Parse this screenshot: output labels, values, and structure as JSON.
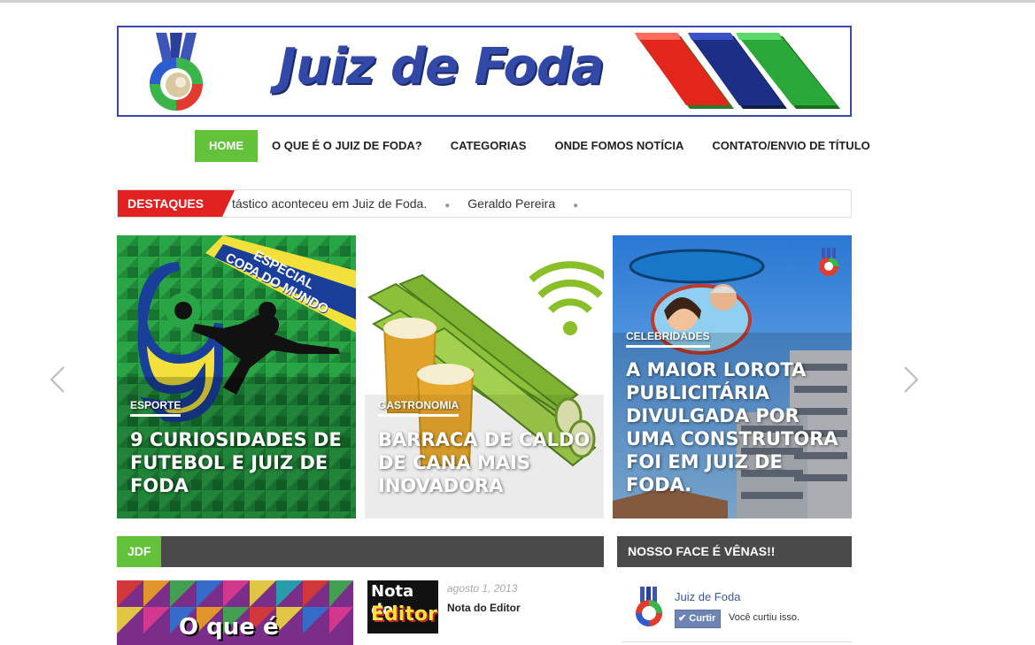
{
  "site": {
    "title": "Juiz de Foda",
    "brand_green": "#63c23a",
    "brand_red": "#e22121",
    "brand_blue": "#3249a8"
  },
  "nav": {
    "items": [
      {
        "label": "HOME",
        "active": true
      },
      {
        "label": "O QUE É O JUIZ DE FODA?"
      },
      {
        "label": "CATEGORIAS"
      },
      {
        "label": "ONDE FOMOS NOTÍCIA"
      },
      {
        "label": "CONTATO/ENVIO DE TÍTULO"
      }
    ]
  },
  "ticker": {
    "label": "DESTAQUES",
    "items": [
      "tástico aconteceu em Juiz de Foda.",
      "Geraldo Pereira"
    ]
  },
  "slider": {
    "slides": [
      {
        "category": "ESPORTE",
        "title": "9 CURIOSIDADES DE FUTEBOL E JUIZ DE FODA",
        "badge_line1": "ESPECIAL",
        "badge_line2": "COPA DO MUNDO"
      },
      {
        "category": "GASTRONOMIA",
        "title": "BARRACA DE CALDO DE CANA MAIS INOVADORA"
      },
      {
        "category": "CELEBRIDADES",
        "title": "A MAIOR LOROTA PUBLICITÁRIA DIVULGADA POR UMA CONSTRUTORA FOI EM JUIZ DE FODA."
      }
    ],
    "prev_icon": "chevron-left-icon",
    "next_icon": "chevron-right-icon"
  },
  "sections": {
    "jdf": {
      "label": "JDF",
      "featured_overlay": "O que é",
      "post": {
        "thumb_line1": "Nota do",
        "thumb_line2": "Editor",
        "date": "agosto 1, 2013",
        "title": "Nota do Editor"
      }
    },
    "facebook": {
      "label": "NOSSO FACE É VÊNAS!!",
      "page_name": "Juiz de Foda",
      "like_button": "Curtir",
      "liked_text": "Você curtiu isso."
    }
  }
}
